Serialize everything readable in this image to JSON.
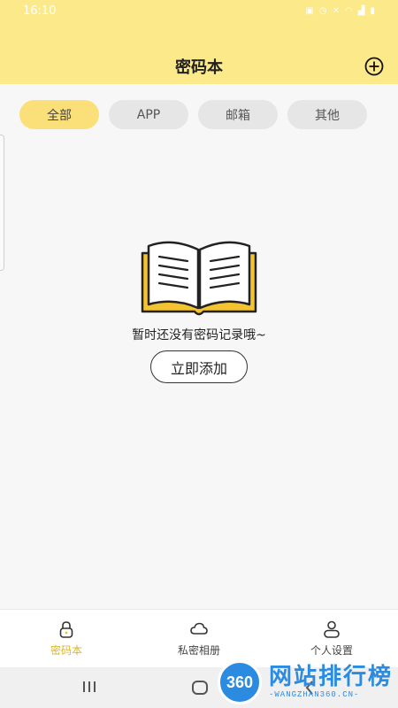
{
  "status_bar": {
    "time": "16:10",
    "indicators": [
      "vpn-icon",
      "alarm-icon",
      "mute-icon",
      "wifi-icon",
      "signal-icon",
      "battery-icon"
    ]
  },
  "header": {
    "title": "密码本",
    "add_icon": "plus-circle-icon"
  },
  "filters": {
    "items": [
      {
        "label": "全部",
        "active": true
      },
      {
        "label": "APP",
        "active": false
      },
      {
        "label": "邮箱",
        "active": false
      },
      {
        "label": "其他",
        "active": false
      }
    ]
  },
  "empty_state": {
    "illustration": "open-book-icon",
    "message": "暂时还没有密码记录哦~",
    "button_label": "立即添加"
  },
  "tabbar": {
    "items": [
      {
        "label": "密码本",
        "icon": "lock-icon",
        "active": true
      },
      {
        "label": "私密相册",
        "icon": "cloud-icon",
        "active": false
      },
      {
        "label": "个人设置",
        "icon": "person-icon",
        "active": false
      }
    ]
  },
  "navbar": {
    "buttons": [
      "recents-icon",
      "home-icon",
      "back-icon"
    ]
  },
  "watermark": {
    "badge": "360",
    "title": "网站排行榜",
    "subtitle": "-WANGZHAN360.CN-"
  },
  "colors": {
    "header_bg": "#fbe98a",
    "accent": "#fbe07a",
    "active_tab": "#d9b52b",
    "watermark_blue": "#2a8be0"
  }
}
